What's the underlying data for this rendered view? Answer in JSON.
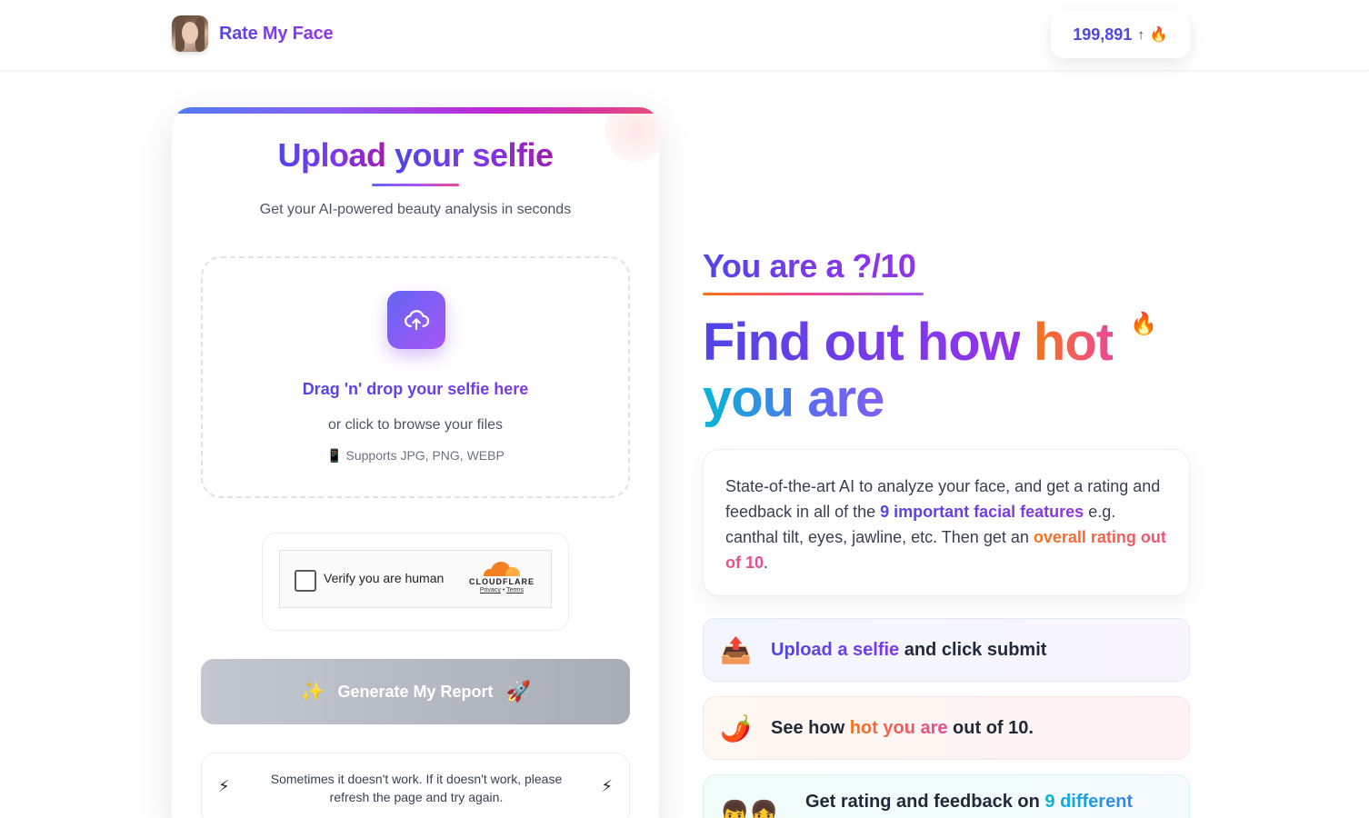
{
  "header": {
    "brand_name": "Rate My Face",
    "counter_value": "199,891",
    "counter_arrow": "↑",
    "counter_fire": "🔥"
  },
  "upload_card": {
    "title_part1": "Upload",
    "title_part2": "your selfie",
    "subtitle": "Get your AI-powered beauty analysis in seconds",
    "drop_main": "Drag 'n' drop your selfie here",
    "drop_sub": "or click to browse your files",
    "formats_icon": "📱",
    "formats": "Supports JPG, PNG, WEBP",
    "captcha_label": "Verify you are human",
    "captcha_brand": "CLOUDFLARE",
    "captcha_privacy": "Privacy",
    "captcha_sep": "•",
    "captcha_terms": "Terms",
    "generate_left_emoji": "✨",
    "generate_label": "Generate My Report",
    "generate_right_emoji": "🚀",
    "notice_icon": "⚡",
    "notice_text": "Sometimes it doesn't work. If it doesn't work, please refresh the page and try again."
  },
  "hero": {
    "rating_text": "You are a ?/10",
    "line1_part1": "Find out how",
    "line1_hot": "hot",
    "line2": "you are",
    "fire_icon": "🔥"
  },
  "description": {
    "part1": "State-of-the-art AI to analyze your face, and get a rating and feedback in all of the ",
    "features": "9 important facial features",
    "part2": " e.g. canthal tilt, eyes, jawline, etc. Then get an ",
    "overall": "overall rating out of 10",
    "part3": "."
  },
  "steps": [
    {
      "icon": "📤",
      "highlight": "Upload a selfie",
      "rest": " and click submit"
    },
    {
      "icon": "🌶️",
      "prefix": "See how ",
      "highlight": "hot you are",
      "rest": " out of 10."
    },
    {
      "icon": "👦👧",
      "prefix": "Get rating and feedback on ",
      "highlight": "9 different"
    }
  ],
  "colors": {
    "brand_primary": "#4f46e5",
    "brand_purple": "#7c3aed",
    "hot_orange": "#f97316",
    "hot_pink": "#ec4899",
    "cyan": "#06b6d4"
  }
}
